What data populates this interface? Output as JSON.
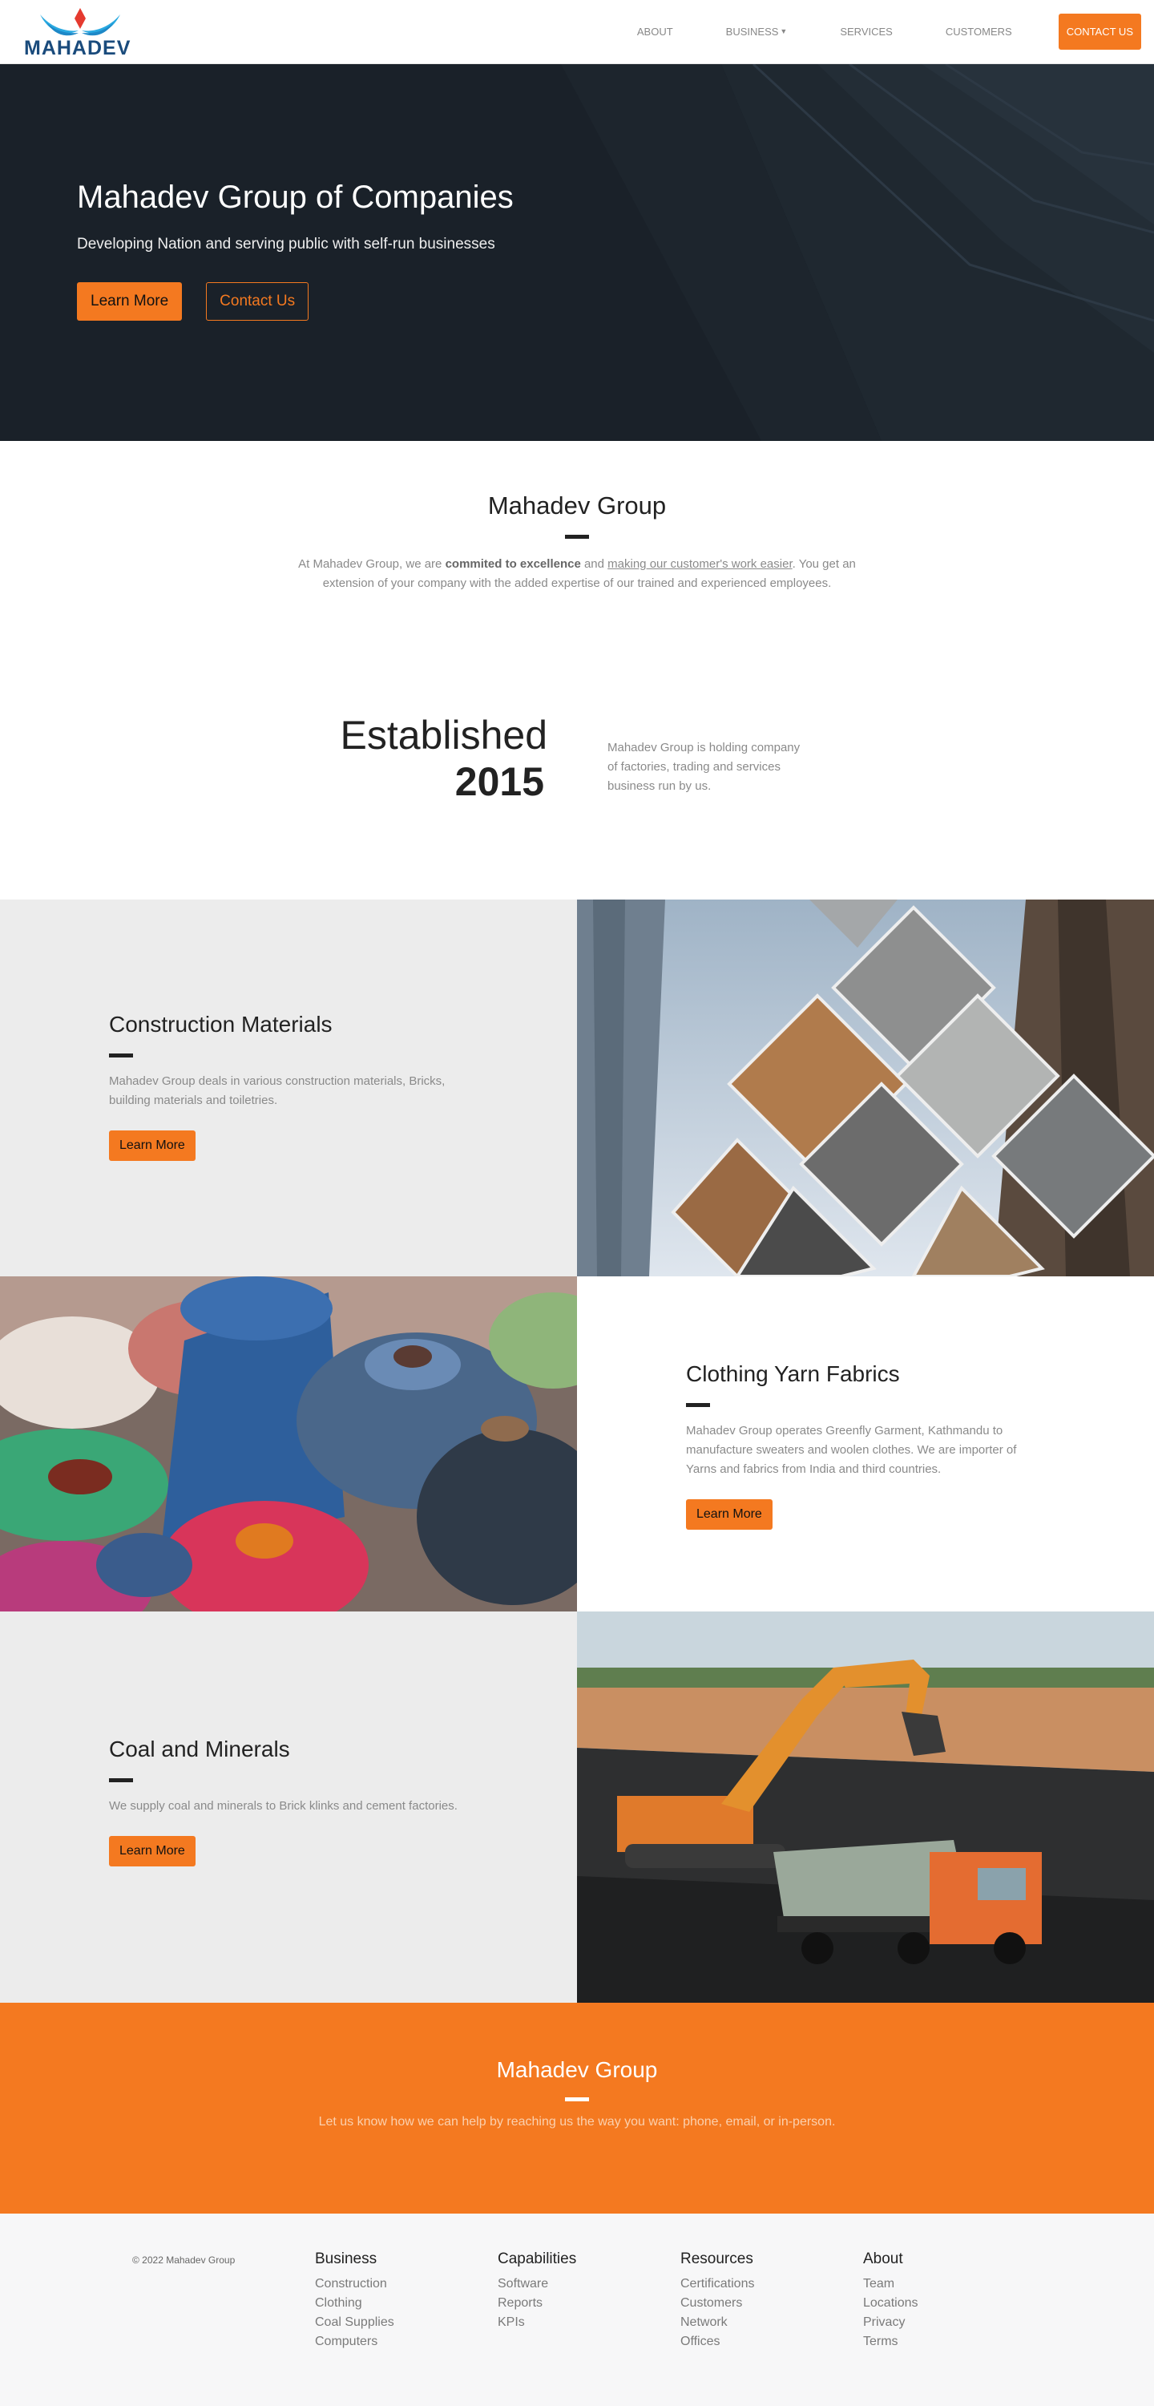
{
  "brand": {
    "name": "MAHADEV",
    "accent": "#f47920",
    "logo_blue": "#1a4b7c"
  },
  "nav": {
    "links": [
      "ABOUT",
      "BUSINESS",
      "SERVICES",
      "CUSTOMERS"
    ],
    "cta": "CONTACT US"
  },
  "hero": {
    "title": "Mahadev Group of Companies",
    "subtitle": "Developing Nation and serving public with self-run businesses",
    "primary_button": "Learn More",
    "secondary_button": "Contact Us"
  },
  "intro": {
    "title": "Mahadev Group",
    "text_1": "At Mahadev Group, we are ",
    "text_bold": "commited to excellence",
    "text_2": " and ",
    "text_underline": "making our customer's work easier",
    "text_3": ". You get an extension of your company with the added expertise of our trained and experienced employees."
  },
  "established": {
    "word": "Established",
    "year": "2015",
    "description": "Mahadev Group is holding company of factories, trading and services business run by us."
  },
  "features": [
    {
      "title": "Construction Materials",
      "description": "Mahadev Group deals in various construction materials, Bricks, building materials and toiletries.",
      "button": "Learn More"
    },
    {
      "title": "Clothing Yarn Fabrics",
      "description": "Mahadev Group operates Greenfly Garment, Kathmandu to manufacture sweaters and woolen clothes. We are importer of Yarns and fabrics from India and third countries.",
      "button": "Learn More"
    },
    {
      "title": "Coal and Minerals",
      "description": "We supply coal and minerals to Brick klinks and cement factories.",
      "button": "Learn More"
    }
  ],
  "cta": {
    "title": "Mahadev Group",
    "text": "Let us know how we can help by reaching us the way you want: phone, email, or in-person."
  },
  "footer": {
    "copyright": "© 2022 Mahadev Group",
    "columns": [
      {
        "title": "Business",
        "links": [
          "Construction",
          "Clothing",
          "Coal Supplies",
          "Computers"
        ]
      },
      {
        "title": "Capabilities",
        "links": [
          "Software",
          "Reports",
          "KPIs"
        ]
      },
      {
        "title": "Resources",
        "links": [
          "Certifications",
          "Customers",
          "Network",
          "Offices"
        ]
      },
      {
        "title": "About",
        "links": [
          "Team",
          "Locations",
          "Privacy",
          "Terms"
        ]
      }
    ]
  }
}
